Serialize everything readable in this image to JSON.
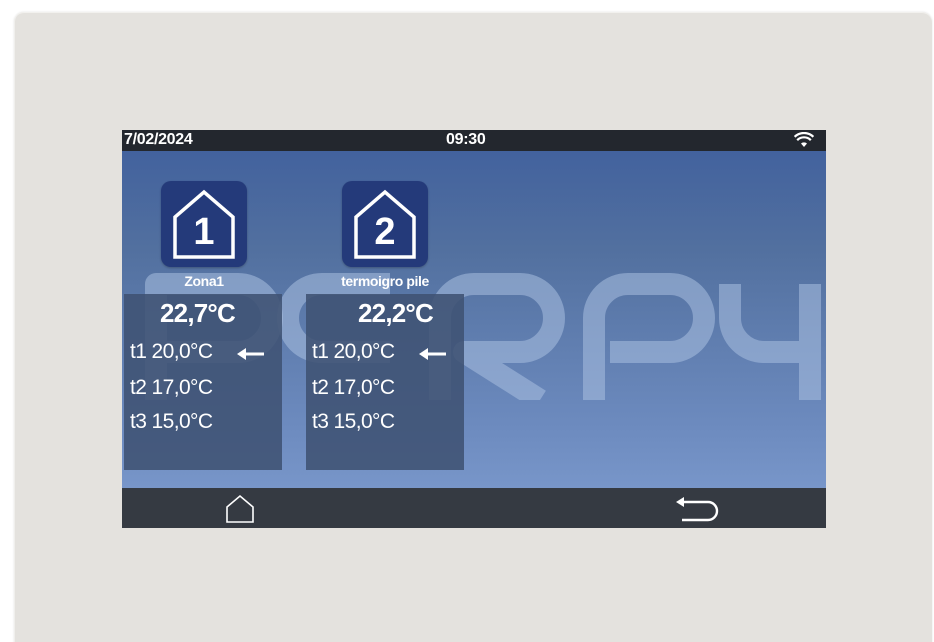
{
  "status_bar": {
    "date": "7/02/2024",
    "time": "09:30",
    "wifi_icon": "wifi-icon"
  },
  "watermark": {
    "text": "PERRY",
    "color": "#a9bfe0"
  },
  "zones": [
    {
      "number": "1",
      "name": "Zona1",
      "temperature": "22,7°C",
      "setpoints": [
        {
          "label": "t1 20,0°C",
          "active": true
        },
        {
          "label": "t2 17,0°C",
          "active": false
        },
        {
          "label": "t3 15,0°C",
          "active": false
        }
      ]
    },
    {
      "number": "2",
      "name": "termoigro pile",
      "temperature": "22,2°C",
      "setpoints": [
        {
          "label": "t1 20,0°C",
          "active": true
        },
        {
          "label": "t2 17,0°C",
          "active": false
        },
        {
          "label": "t3 15,0°C",
          "active": false
        }
      ]
    }
  ],
  "nav": {
    "home_icon": "home-icon",
    "back_icon": "back-icon"
  },
  "colors": {
    "status_bar": "#23272e",
    "nav_bar": "#353a42",
    "zone_icon": "#243a7a",
    "panel": "#3f5273",
    "screen_top": "#3f5f9e",
    "screen_bottom": "#7f9dd0"
  }
}
